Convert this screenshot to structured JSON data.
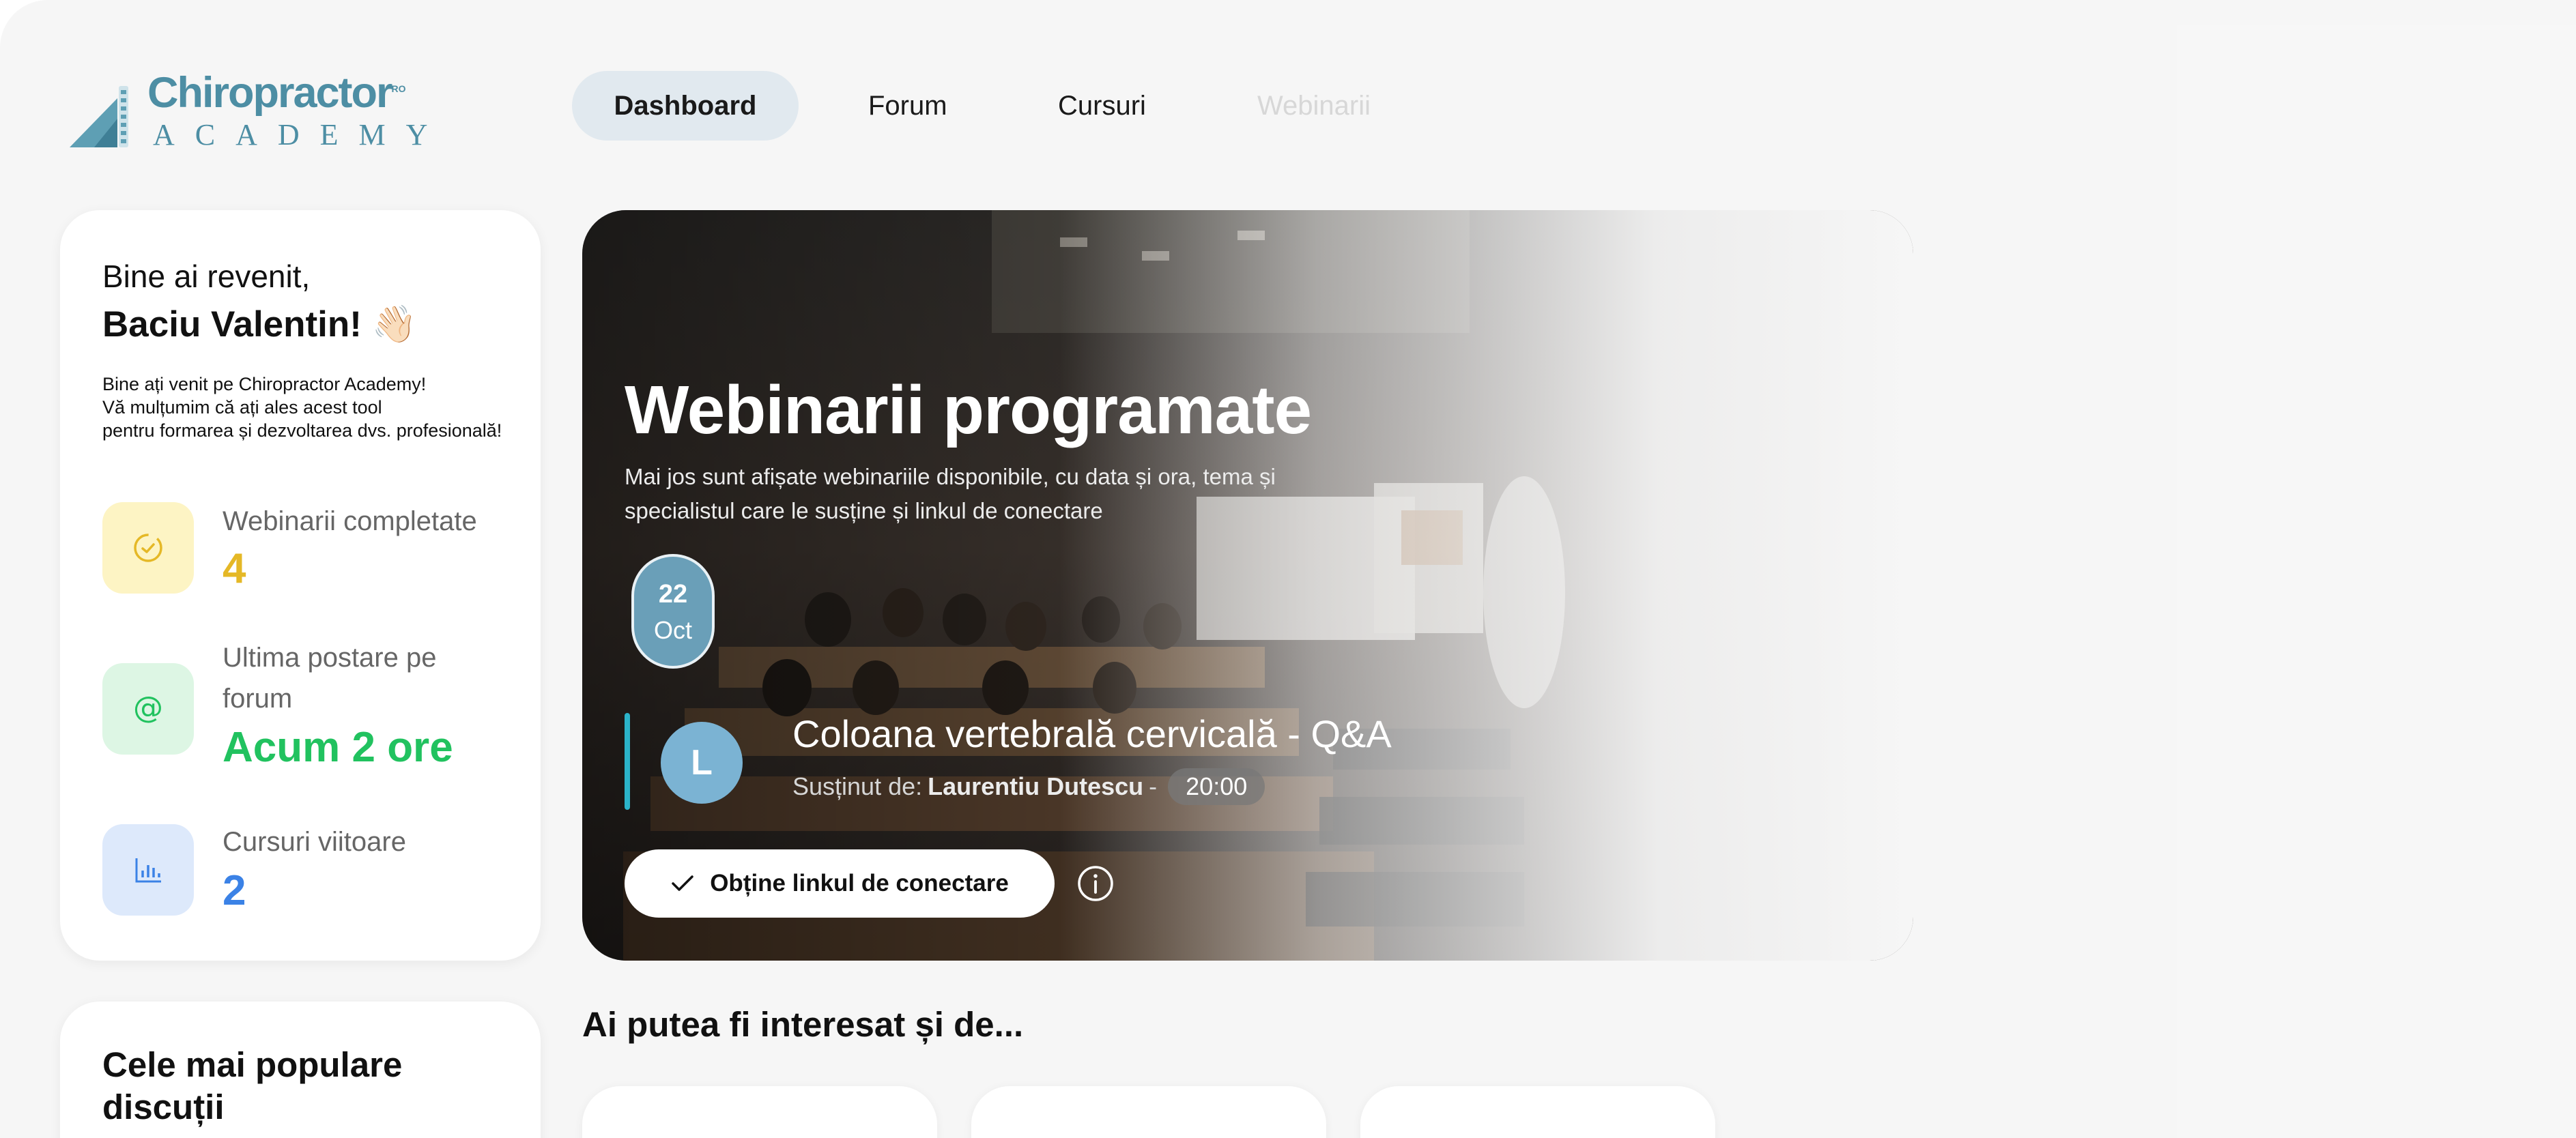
{
  "brand": {
    "name": "Chiropractor",
    "registered": "RO",
    "subtitle": "ACADEMY"
  },
  "nav": {
    "tabs": [
      {
        "label": "Dashboard",
        "active": true
      },
      {
        "label": "Forum"
      },
      {
        "label": "Cursuri"
      },
      {
        "label": "Webinarii"
      }
    ]
  },
  "welcome": {
    "greeting": "Bine ai revenit,",
    "user": "Baciu Valentin! 👋🏻",
    "line1": "Bine ați venit pe Chiropractor Academy!",
    "line2": "Vă mulțumim că ați ales acest tool",
    "line3": "pentru formarea și dezvoltarea dvs. profesională!"
  },
  "stats": [
    {
      "label": "Webinarii completate",
      "value": "4",
      "icon": "clock-check-icon",
      "color": "#e5b826",
      "bg": "#fdf4c4"
    },
    {
      "label": "Ultima postare pe forum",
      "value": "Acum 2 ore",
      "icon": "at-icon",
      "color": "#21c25f",
      "bg": "#ddf6e4"
    },
    {
      "label": "Cursuri viitoare",
      "value": "2",
      "icon": "bar-chart-icon",
      "color": "#3b82e6",
      "bg": "#dde9fb"
    }
  ],
  "popular": {
    "title": "Cele mai populare discuții"
  },
  "hero": {
    "title": "Webinarii programate",
    "subtitle": "Mai jos sunt afișate webinariile disponibile, cu data și ora, tema și specialistul care le susține și linkul de conectare",
    "date_day": "22",
    "date_month": "Oct",
    "avatar_letter": "L",
    "event_title": "Coloana vertebrală cervicală - Q&A",
    "by_label": "Susținut de:",
    "speaker": "Laurentiu Dutescu",
    "separator": "-",
    "time": "20:00",
    "connect_label": "Obține linkul de conectare",
    "accent": "#2bb3c9"
  },
  "suggest": {
    "title": "Ai putea fi interesat și de..."
  }
}
